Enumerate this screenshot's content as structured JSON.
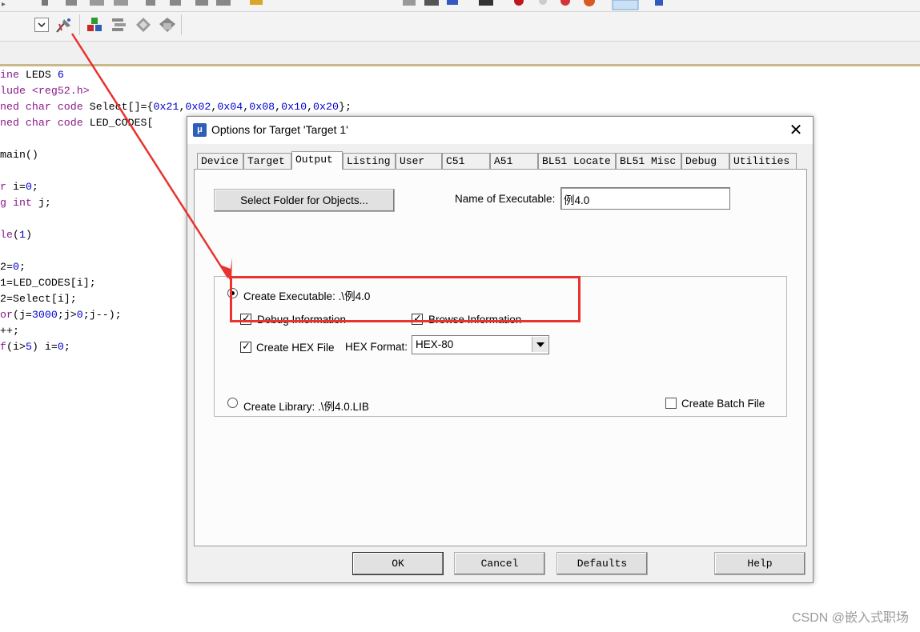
{
  "dialog": {
    "title": "Options for Target 'Target 1'",
    "tabs": [
      "Device",
      "Target",
      "Output",
      "Listing",
      "User",
      "C51",
      "A51",
      "BL51 Locate",
      "BL51 Misc",
      "Debug",
      "Utilities"
    ],
    "active_tab": "Output",
    "select_folder_label": "Select Folder for Objects...",
    "name_exe_label": "Name of Executable:",
    "name_exe_value": "例4.0",
    "create_executable_label": "Create Executable:  .\\例4.0",
    "debug_info_label": "Debug Information",
    "browse_info_label": "Browse Information",
    "create_hex_label": "Create HEX File",
    "hex_format_label": "HEX Format:",
    "hex_format_value": "HEX-80",
    "create_library_label": "Create Library:  .\\例4.0.LIB",
    "create_batch_label": "Create Batch File",
    "ok_label": "OK",
    "cancel_label": "Cancel",
    "defaults_label": "Defaults",
    "help_label": "Help",
    "close_glyph": "✕"
  },
  "state": {
    "create_executable": true,
    "debug_information": true,
    "browse_information": true,
    "create_hex_file": true,
    "create_library": false,
    "create_batch_file": false
  },
  "code": {
    "lines": [
      "ine LEDS 6",
      "lude <reg52.h>",
      "ned char code Select[]={0x21,0x02,0x04,0x08,0x10,0x20};",
      "ned char code LED_CODES[",
      "",
      "main()",
      "",
      "r i=0;",
      "g int j;",
      "",
      "le(1)",
      "",
      "2=0;",
      "1=LED_CODES[i];",
      "2=Select[i];",
      "or(j=3000;j>0;j--);",
      "++;",
      "f(i>5) i=0;"
    ]
  },
  "watermark": "CSDN @嵌入式职场",
  "colors": {
    "annotation": "#e8332e",
    "title_icon": "#2d5fb8"
  }
}
